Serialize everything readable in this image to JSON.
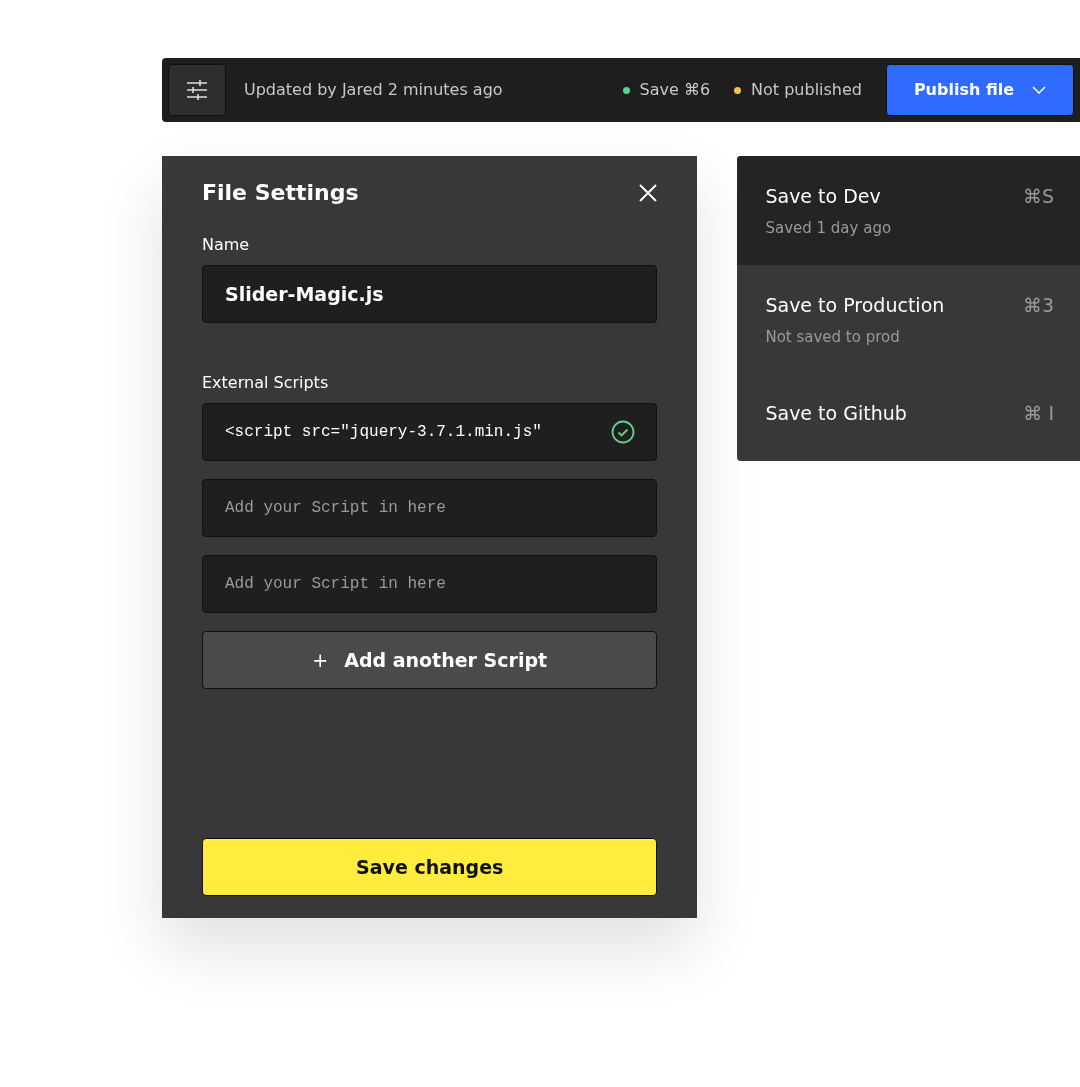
{
  "toolbar": {
    "updated": "Updated by Jared 2 minutes ago",
    "statuses": [
      {
        "label": "Save ⌘6",
        "color": "#5fd08a"
      },
      {
        "label": "Not published",
        "color": "#f5c542"
      }
    ],
    "publish_button": "Publish file"
  },
  "file_settings": {
    "title": "File Settings",
    "name_label": "Name",
    "name_value": "Slider-Magic.js",
    "scripts_label": "External Scripts",
    "scripts": [
      {
        "value": "<script src=\"jquery-3.7.1.min.js\"",
        "valid": true
      },
      {
        "placeholder": "Add your Script in here",
        "valid": false
      },
      {
        "placeholder": "Add your Script in here",
        "valid": false
      }
    ],
    "add_button": {
      "icon": "+",
      "label": "Add another Script"
    },
    "save_button": "Save changes"
  },
  "save_menu": [
    {
      "label": "Save to Dev",
      "note": "Saved 1 day ago",
      "shortcut": "⌘S",
      "selected": true
    },
    {
      "label": "Save to Production",
      "note": "Not saved to prod",
      "shortcut": "⌘3",
      "selected": false
    },
    {
      "label": "Save to Github",
      "shortcut": "⌘ I",
      "selected": false
    }
  ]
}
